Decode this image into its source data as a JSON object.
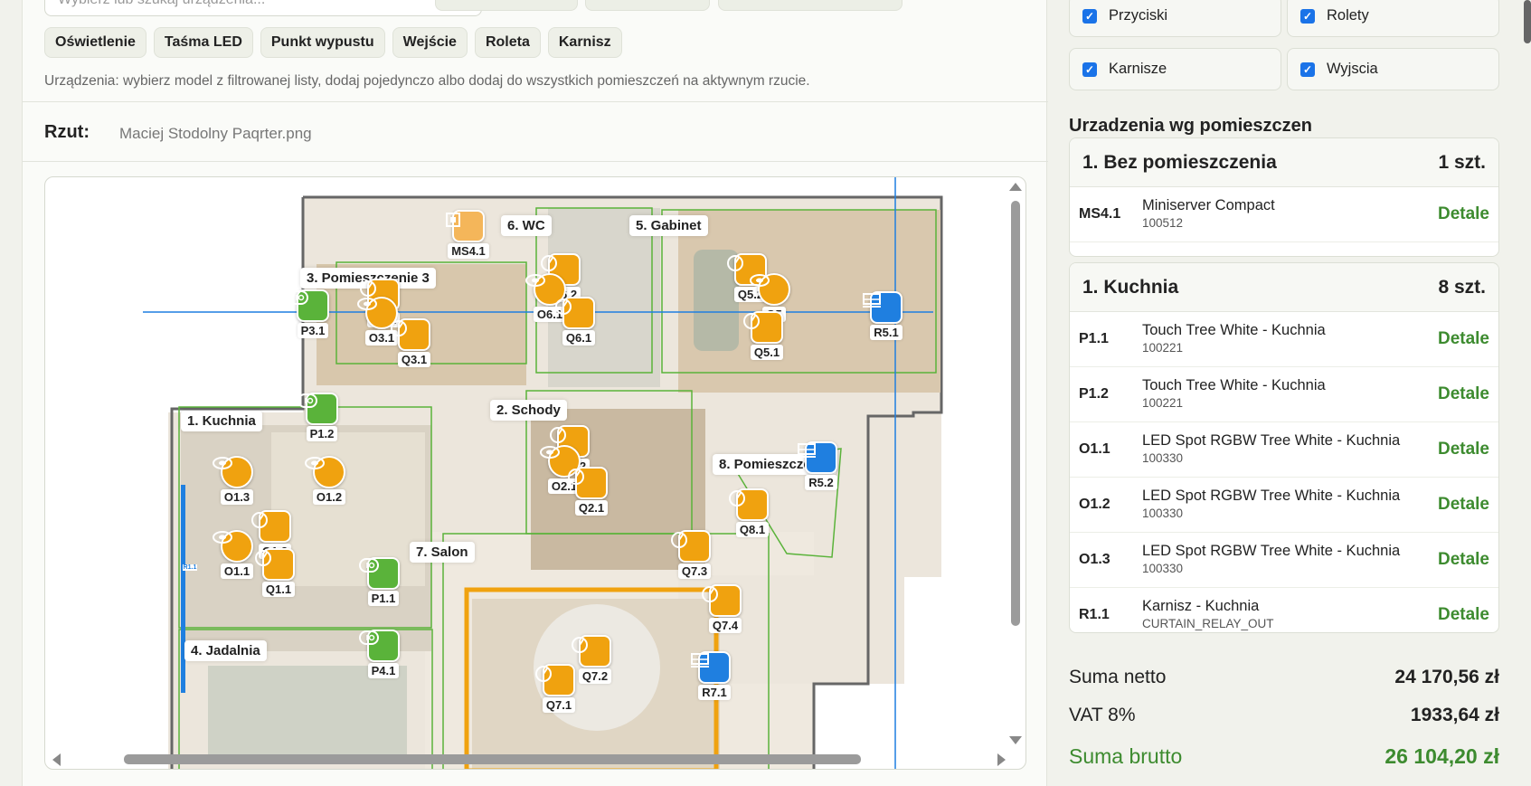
{
  "search": {
    "placeholder": "Wybierz lub szukaj urządzenia..."
  },
  "filter_chips": [
    "Oświetlenie",
    "Taśma LED",
    "Punkt wypustu",
    "Wejście",
    "Roleta",
    "Karnisz"
  ],
  "hint": "Urządzenia: wybierz model z filtrowanej listy, dodaj pojedynczo albo dodaj do wszystkich pomieszczeń na aktywnym rzucie.",
  "rzut": {
    "label": "Rzut:",
    "file": "Maciej Stodolny Paqrter.png"
  },
  "rooms": [
    {
      "name": "1. Kuchnia"
    },
    {
      "name": "2. Schody"
    },
    {
      "name": "3. Pomieszczenie 3"
    },
    {
      "name": "4. Jadalnia"
    },
    {
      "name": "5. Gabinet"
    },
    {
      "name": "6. WC"
    },
    {
      "name": "7. Salon"
    },
    {
      "name": "8. Pomieszczenie"
    }
  ],
  "markers": [
    {
      "code": "MS4.1",
      "type": "server"
    },
    {
      "code": "P3.1",
      "type": "switch"
    },
    {
      "code": "Q3.2",
      "type": "dimmer"
    },
    {
      "code": "O3.1",
      "type": "spot"
    },
    {
      "code": "Q3.1",
      "type": "dimmer"
    },
    {
      "code": "Q6.2",
      "type": "dimmer"
    },
    {
      "code": "O6.1",
      "type": "spot"
    },
    {
      "code": "Q6.1",
      "type": "dimmer"
    },
    {
      "code": "Q5.2",
      "type": "dimmer"
    },
    {
      "code": "O5",
      "type": "spot"
    },
    {
      "code": "Q5.1",
      "type": "dimmer"
    },
    {
      "code": "R5.1",
      "type": "blind"
    },
    {
      "code": "P1.2",
      "type": "switch"
    },
    {
      "code": "O1.3",
      "type": "spot"
    },
    {
      "code": "O1.2",
      "type": "spot"
    },
    {
      "code": "Q1.2",
      "type": "dimmer"
    },
    {
      "code": "O1.1",
      "type": "spot"
    },
    {
      "code": "Q1.1",
      "type": "dimmer"
    },
    {
      "code": "P1.1",
      "type": "switch"
    },
    {
      "code": "P4.1",
      "type": "switch"
    },
    {
      "code": "Q2.2",
      "type": "dimmer"
    },
    {
      "code": "O2.1",
      "type": "spot"
    },
    {
      "code": "Q2.1",
      "type": "dimmer"
    },
    {
      "code": "R5.2",
      "type": "blind"
    },
    {
      "code": "Q8.1",
      "type": "dimmer"
    },
    {
      "code": "Q7.3",
      "type": "dimmer"
    },
    {
      "code": "Q7.4",
      "type": "dimmer"
    },
    {
      "code": "Q7.2",
      "type": "dimmer"
    },
    {
      "code": "Q7.1",
      "type": "dimmer"
    },
    {
      "code": "R7.1",
      "type": "blind"
    },
    {
      "code": "R1.1",
      "type": "curtain"
    }
  ],
  "filters": [
    {
      "label": "Przyciski",
      "checked": true
    },
    {
      "label": "Rolety",
      "checked": true
    },
    {
      "label": "Karnisze",
      "checked": true
    },
    {
      "label": "Wyjscia",
      "checked": true
    }
  ],
  "section_title": "Urzadzenia wg pomieszczen",
  "groups": [
    {
      "name": "1. Bez pomieszczenia",
      "count": "1 szt.",
      "items": [
        {
          "code": "MS4.1",
          "name": "Miniserver Compact",
          "sku": "100512",
          "action": "Detale"
        }
      ]
    },
    {
      "name": "1. Kuchnia",
      "count": "8 szt.",
      "items": [
        {
          "code": "P1.1",
          "name": "Touch Tree White - Kuchnia",
          "sku": "100221",
          "action": "Detale"
        },
        {
          "code": "P1.2",
          "name": "Touch Tree White - Kuchnia",
          "sku": "100221",
          "action": "Detale"
        },
        {
          "code": "O1.1",
          "name": "LED Spot RGBW Tree White - Kuchnia",
          "sku": "100330",
          "action": "Detale"
        },
        {
          "code": "O1.2",
          "name": "LED Spot RGBW Tree White - Kuchnia",
          "sku": "100330",
          "action": "Detale"
        },
        {
          "code": "O1.3",
          "name": "LED Spot RGBW Tree White - Kuchnia",
          "sku": "100330",
          "action": "Detale"
        },
        {
          "code": "R1.1",
          "name": "Karnisz - Kuchnia",
          "sku": "CURTAIN_RELAY_OUT",
          "action": "Detale"
        }
      ]
    }
  ],
  "totals": [
    {
      "label": "Suma netto",
      "value": "24 170,56 zł"
    },
    {
      "label": "VAT 8%",
      "value": "1933,64 zł"
    },
    {
      "label": "Suma brutto",
      "value": "26 104,20 zł"
    }
  ],
  "colors": {
    "accent_green": "#3d8b2f",
    "marker_orange": "#f0a20f",
    "marker_green": "#5ab33a",
    "marker_blue": "#1f7fe0",
    "checkbox_blue": "#1a73e8"
  }
}
